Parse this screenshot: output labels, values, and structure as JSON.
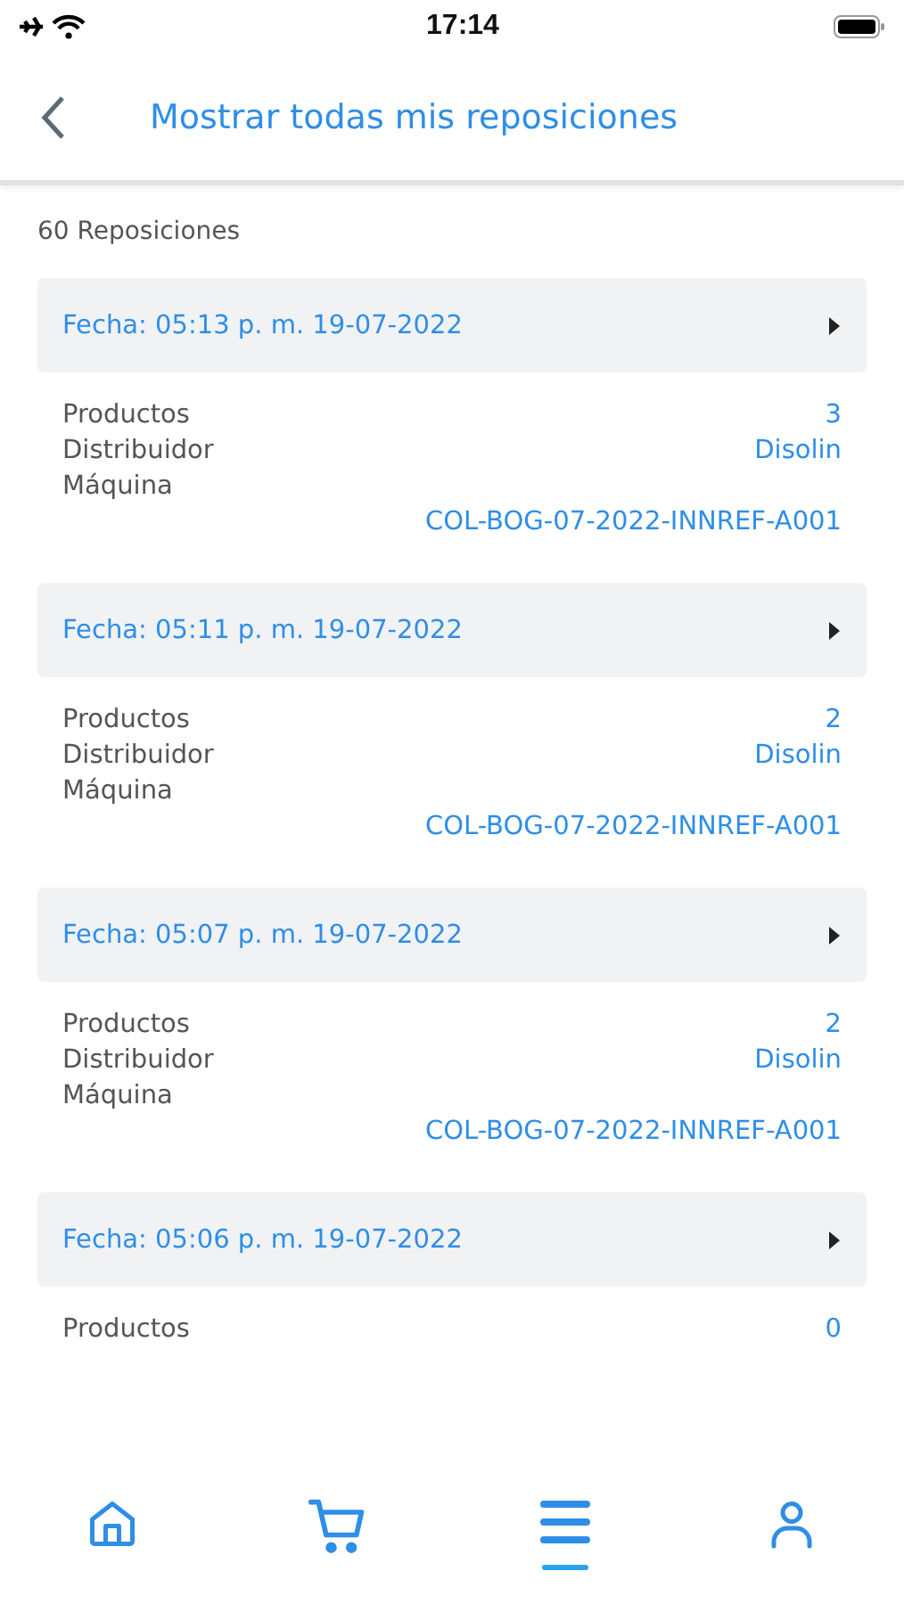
{
  "status_bar": {
    "time": "17:14"
  },
  "header": {
    "title": "Mostrar todas mis reposiciones"
  },
  "count": "60 Reposiciones",
  "cards": [
    {
      "date": "Fecha: 05:13 p. m. 19-07-2022",
      "rows": [
        {
          "label": "Productos",
          "value": "3"
        },
        {
          "label": "Distribuidor",
          "value": "Disolin"
        },
        {
          "label": "Máquina"
        }
      ],
      "machine": "COL-BOG-07-2022-INNREF-A001"
    },
    {
      "date": "Fecha: 05:11 p. m. 19-07-2022",
      "rows": [
        {
          "label": "Productos",
          "value": "2"
        },
        {
          "label": "Distribuidor",
          "value": "Disolin"
        },
        {
          "label": "Máquina"
        }
      ],
      "machine": "COL-BOG-07-2022-INNREF-A001"
    },
    {
      "date": "Fecha: 05:07 p. m. 19-07-2022",
      "rows": [
        {
          "label": "Productos",
          "value": "2"
        },
        {
          "label": "Distribuidor",
          "value": "Disolin"
        },
        {
          "label": "Máquina"
        }
      ],
      "machine": "COL-BOG-07-2022-INNREF-A001"
    },
    {
      "date": "Fecha: 05:06 p. m. 19-07-2022",
      "rows": [
        {
          "label": "Productos",
          "value": "0"
        }
      ]
    }
  ],
  "nav": [
    {
      "kind": "home",
      "selected": false
    },
    {
      "kind": "cart",
      "selected": false
    },
    {
      "kind": "menu",
      "selected": true
    },
    {
      "kind": "profile",
      "selected": false
    }
  ]
}
